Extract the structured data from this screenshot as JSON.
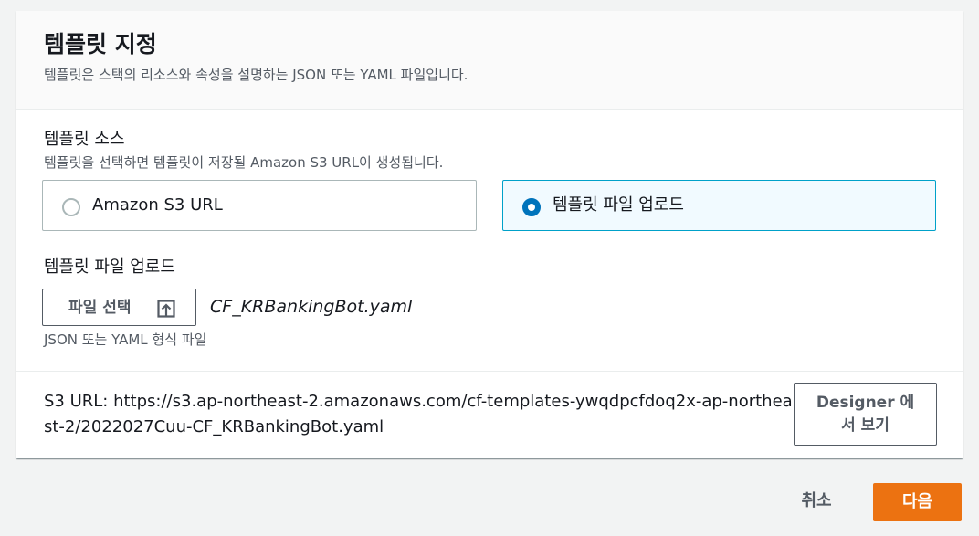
{
  "panel": {
    "title": "템플릿 지정",
    "description": "템플릿은 스택의 리소스와 속성을 설명하는 JSON 또는 YAML 파일입니다."
  },
  "template_source": {
    "label": "템플릿 소스",
    "description": "템플릿을 선택하면 템플릿이 저장될 Amazon S3 URL이 생성됩니다.",
    "options": [
      {
        "label": "Amazon S3 URL",
        "selected": false
      },
      {
        "label": "템플릿 파일 업로드",
        "selected": true
      }
    ]
  },
  "upload": {
    "label": "템플릿 파일 업로드",
    "button_label": "파일 선택",
    "button_icon": "upload-icon",
    "file_name": "CF_KRBankingBot.yaml",
    "hint": "JSON 또는 YAML 형식 파일"
  },
  "s3": {
    "text": "S3 URL:  https://s3.ap-northeast-2.amazonaws.com/cf-templates-ywqdpcfdoq2x-ap-northeast-2/2022027Cuu-CF_KRBankingBot.yaml",
    "designer_button": "Designer 에서 보기"
  },
  "footer": {
    "cancel_label": "취소",
    "next_label": "다음"
  },
  "colors": {
    "primary_button": "#ec7211",
    "selected_border": "#00a1c9",
    "selected_background": "#f1faff",
    "radio_selected": "#0073bb"
  }
}
